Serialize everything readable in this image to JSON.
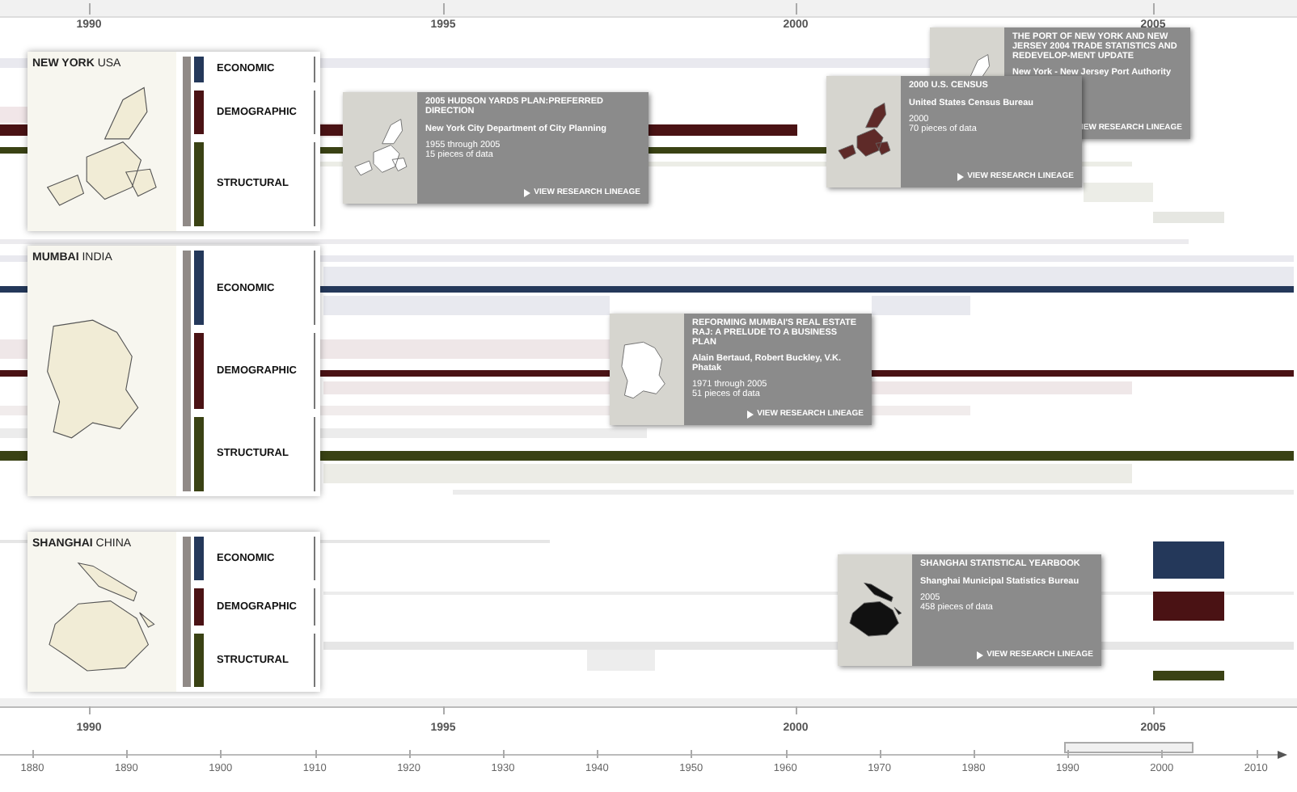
{
  "top_axis": {
    "ticks": [
      "1990",
      "1995",
      "2000",
      "2005"
    ]
  },
  "cities": [
    {
      "title": "**NEW YORK** USA",
      "tracks": [
        {
          "kind": "economic",
          "label": "ECONOMIC"
        },
        {
          "kind": "demographic",
          "label": "DEMOGRAPHIC"
        },
        {
          "kind": "structural",
          "label": "STRUCTURAL"
        }
      ]
    },
    {
      "title": "**MUMBAI** INDIA",
      "tracks": [
        {
          "kind": "economic",
          "label": "ECONOMIC"
        },
        {
          "kind": "demographic",
          "label": "DEMOGRAPHIC"
        },
        {
          "kind": "structural",
          "label": "STRUCTURAL"
        }
      ]
    },
    {
      "title": "**SHANGHAI** CHINA",
      "tracks": [
        {
          "kind": "economic",
          "label": "ECONOMIC"
        },
        {
          "kind": "demographic",
          "label": "DEMOGRAPHIC"
        },
        {
          "kind": "structural",
          "label": "STRUCTURAL"
        }
      ]
    }
  ],
  "research_cards": [
    {
      "title": "THE PORT OF NEW YORK AND NEW JERSEY 2004 TRADE STATISTICS AND REDEVELOP-MENT UPDATE",
      "source": "New York - New Jersey Port Authority",
      "link": "IEW RESEARCH LINEAGE",
      "link_icon": false
    },
    {
      "title": "2005 HUDSON YARDS PLAN:PREFERRED DIRECTION",
      "source": "New York City Department of City Planning",
      "period": "1955 through 2005",
      "count": "15 pieces of data",
      "link": "VIEW RESEARCH LINEAGE",
      "link_icon": true
    },
    {
      "title": "2000 U.S. CENSUS",
      "source": "United States Census Bureau",
      "period": "2000",
      "count": "70 pieces of data",
      "link": "VIEW RESEARCH LINEAGE",
      "link_icon": true
    },
    {
      "title": "REFORMING MUMBAI'S REAL ESTATE RAJ: A PRELUDE TO A BUSINESS PLAN",
      "source": "Alain Bertaud, Robert Buckley, V.K. Phatak",
      "period": "1971 through 2005",
      "count": "51 pieces of data",
      "link": "VIEW RESEARCH LINEAGE",
      "link_icon": true
    },
    {
      "title": "SHANGHAI STATISTICAL YEARBOOK",
      "source": "Shanghai Municipal Statistics Bureau",
      "period": "2005",
      "count": "458 pieces of data",
      "link": "VIEW RESEARCH LINEAGE",
      "link_icon": true
    }
  ],
  "bottom_axis": {
    "ticks": [
      "1990",
      "1995",
      "2000",
      "2005"
    ]
  },
  "overview_axis": {
    "ticks": [
      "1880",
      "1890",
      "1900",
      "1910",
      "1920",
      "1930",
      "1940",
      "1950",
      "1960",
      "1970",
      "1980",
      "1990",
      "2000",
      "2010"
    ]
  }
}
